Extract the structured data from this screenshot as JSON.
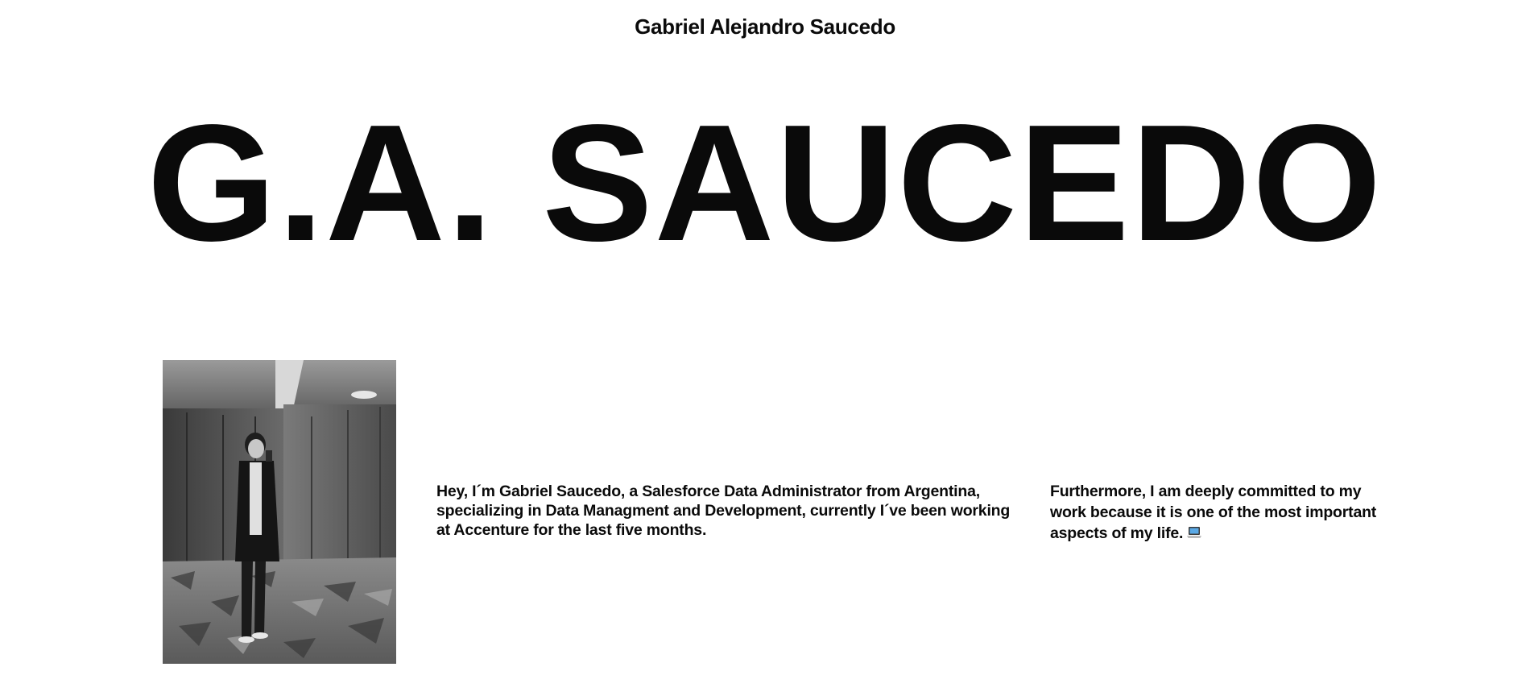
{
  "header": {
    "site_name": "Gabriel Alejandro Saucedo"
  },
  "hero": {
    "title": "G.A. SAUCEDO"
  },
  "about": {
    "portrait_alt": "portrait-photo",
    "intro_text": "Hey, I´m Gabriel Saucedo, a Salesforce Data Administrator from Argentina, specializing in Data Managment and Development, currently I´ve been working at Accenture for the last five months.",
    "commitment_text": "Furthermore, I am deeply committed to my work because it is one of the most important aspects of my life.",
    "commitment_icon": "laptop-icon"
  }
}
